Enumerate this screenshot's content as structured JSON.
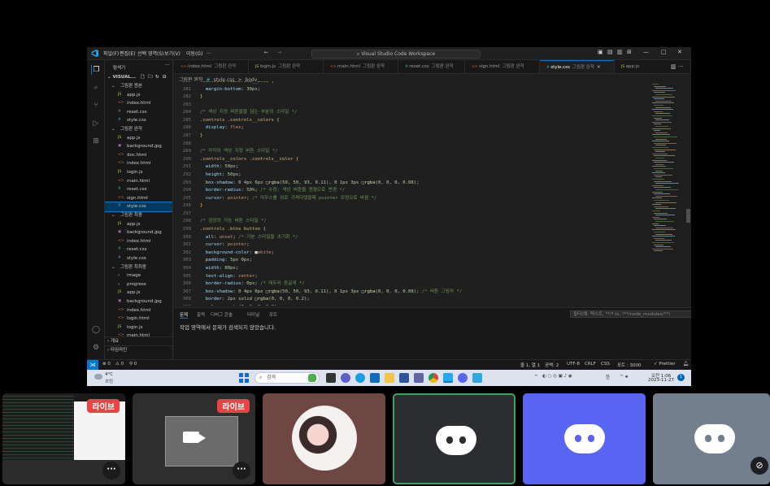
{
  "window": {
    "menu": [
      "파일(F)",
      "편집(E)",
      "선택 영역(S)",
      "보기(V)",
      "이동(G)",
      "..."
    ],
    "command_center": "Visual Studio Code Workspace"
  },
  "sidebar": {
    "title": "탐색기",
    "workspace": "VISUAL...",
    "items": [
      {
        "label": "그림판 원본",
        "type": "folder",
        "depth": 1,
        "open": true
      },
      {
        "label": "app.js",
        "type": "js",
        "depth": 2
      },
      {
        "label": "index.html",
        "type": "html",
        "depth": 2
      },
      {
        "label": "reset.css",
        "type": "css",
        "depth": 2
      },
      {
        "label": "style.css",
        "type": "css",
        "depth": 2
      },
      {
        "label": "그림판 완작",
        "type": "folder",
        "depth": 1,
        "open": true
      },
      {
        "label": "app.js",
        "type": "js",
        "depth": 2
      },
      {
        "label": "background.jpg",
        "type": "img",
        "depth": 2
      },
      {
        "label": "doc.html",
        "type": "html",
        "depth": 2
      },
      {
        "label": "index.html",
        "type": "html",
        "depth": 2
      },
      {
        "label": "login.js",
        "type": "js",
        "depth": 2
      },
      {
        "label": "main.html",
        "type": "html",
        "depth": 2
      },
      {
        "label": "reset.css",
        "type": "css",
        "depth": 2
      },
      {
        "label": "sign.html",
        "type": "html",
        "depth": 2
      },
      {
        "label": "style.css",
        "type": "css",
        "depth": 2,
        "selected": true
      },
      {
        "label": "그림판 최종",
        "type": "folder",
        "depth": 1,
        "open": true
      },
      {
        "label": "app.js",
        "type": "js",
        "depth": 2
      },
      {
        "label": "background.jpg",
        "type": "img",
        "depth": 2
      },
      {
        "label": "index.html",
        "type": "html",
        "depth": 2
      },
      {
        "label": "reset.css",
        "type": "css",
        "depth": 2
      },
      {
        "label": "style.css",
        "type": "css",
        "depth": 2
      },
      {
        "label": "그림판 최최종",
        "type": "folder",
        "depth": 1,
        "open": true
      },
      {
        "label": "image",
        "type": "folder",
        "depth": 2,
        "open": false
      },
      {
        "label": "progress",
        "type": "folder",
        "depth": 2,
        "open": false
      },
      {
        "label": "app.js",
        "type": "js",
        "depth": 2
      },
      {
        "label": "background.jpg",
        "type": "img",
        "depth": 2
      },
      {
        "label": "index.html",
        "type": "html",
        "depth": 2
      },
      {
        "label": "login.html",
        "type": "html",
        "depth": 2
      },
      {
        "label": "login.js",
        "type": "js",
        "depth": 2
      },
      {
        "label": "main.html",
        "type": "html",
        "depth": 2
      }
    ],
    "outline": "개요",
    "timeline": "타임라인"
  },
  "tabs": [
    {
      "file": "index.html",
      "folder": "그림판 완작",
      "type": "html"
    },
    {
      "file": "login.js",
      "folder": "그림판 완작",
      "type": "js"
    },
    {
      "file": "main.html",
      "folder": "그림판 완작",
      "type": "html"
    },
    {
      "file": "reset.css",
      "folder": "그림판 완작",
      "type": "css"
    },
    {
      "file": "sign.html",
      "folder": "그림판 완작",
      "type": "html"
    },
    {
      "file": "style.css",
      "folder": "그림판 완작",
      "type": "css",
      "active": true
    },
    {
      "file": "app.js",
      "folder": "",
      "type": "js"
    }
  ],
  "breadcrumb": [
    "그림판 완작",
    "#",
    "style.css",
    ">",
    "body"
  ],
  "code": [
    {
      "n": "280",
      "parts": [
        [
          ".controls .controls__btns {",
          "sel"
        ]
      ]
    },
    {
      "n": "281",
      "parts": [
        [
          "  margin-bottom",
          "prop"
        ],
        [
          ": ",
          ""
        ],
        [
          "30px",
          "num"
        ],
        [
          ";",
          ""
        ]
      ]
    },
    {
      "n": "282",
      "parts": [
        [
          "}",
          "brace"
        ]
      ]
    },
    {
      "n": "283",
      "parts": []
    },
    {
      "n": "284",
      "parts": [
        [
          "/* 색상 지정 버튼들을 담는 부분의 스타일 */",
          "cmt"
        ]
      ]
    },
    {
      "n": "285",
      "parts": [
        [
          ".controls .controls__colors {",
          "sel"
        ]
      ]
    },
    {
      "n": "286",
      "parts": [
        [
          "  display",
          "prop"
        ],
        [
          ": ",
          ""
        ],
        [
          "flex",
          "val"
        ],
        [
          ";",
          ""
        ]
      ]
    },
    {
      "n": "287",
      "parts": [
        [
          "}",
          "brace"
        ]
      ]
    },
    {
      "n": "288",
      "parts": []
    },
    {
      "n": "289",
      "parts": [
        [
          "/* 각각의 색상 지정 버튼 스타일 */",
          "cmt"
        ]
      ]
    },
    {
      "n": "290",
      "parts": [
        [
          ".controls__colors .controls__color {",
          "sel"
        ]
      ]
    },
    {
      "n": "291",
      "parts": [
        [
          "  width",
          "prop"
        ],
        [
          ": ",
          ""
        ],
        [
          "50px",
          "num"
        ],
        [
          ";",
          ""
        ]
      ]
    },
    {
      "n": "292",
      "parts": [
        [
          "  height",
          "prop"
        ],
        [
          ": ",
          ""
        ],
        [
          "50px",
          "num"
        ],
        [
          ";",
          ""
        ]
      ]
    },
    {
      "n": "293",
      "parts": [
        [
          "  box-shadow",
          "prop"
        ],
        [
          ": ",
          ""
        ],
        [
          "0 4px 6px ",
          "num"
        ],
        [
          "□",
          ""
        ],
        [
          "rgba",
          "fn"
        ],
        [
          "(50, 50, 93, 0.11), 0 1px 3px ",
          "num"
        ],
        [
          "□",
          ""
        ],
        [
          "rgba",
          "fn"
        ],
        [
          "(0, 0, 0, 0.08);",
          "num"
        ]
      ]
    },
    {
      "n": "294",
      "parts": [
        [
          "  border-radius",
          "prop"
        ],
        [
          ": ",
          ""
        ],
        [
          "50%",
          "num"
        ],
        [
          "; ",
          ""
        ],
        [
          "/* 수정: 색상 버튼을 원형으로 변경 */",
          "cmt"
        ]
      ]
    },
    {
      "n": "295",
      "parts": [
        [
          "  cursor",
          "prop"
        ],
        [
          ": ",
          ""
        ],
        [
          "pointer",
          "val"
        ],
        [
          "; ",
          ""
        ],
        [
          "/* 마우스를 위로 가져다댔을때 pointer 모양으로 바뀜 */",
          "cmt"
        ]
      ]
    },
    {
      "n": "296",
      "parts": [
        [
          "}",
          "brace"
        ]
      ]
    },
    {
      "n": "297",
      "parts": []
    },
    {
      "n": "298",
      "parts": [
        [
          "/* 검정의 기능 버튼 스타일 */",
          "cmt"
        ]
      ]
    },
    {
      "n": "299",
      "parts": [
        [
          ".controls .btns button {",
          "sel"
        ]
      ]
    },
    {
      "n": "300",
      "parts": [
        [
          "  all",
          "prop"
        ],
        [
          ": ",
          ""
        ],
        [
          "unset",
          "val"
        ],
        [
          "; ",
          ""
        ],
        [
          "/* 기본 스타일을 초기화 */",
          "cmt"
        ]
      ]
    },
    {
      "n": "301",
      "parts": [
        [
          "  cursor",
          "prop"
        ],
        [
          ": ",
          ""
        ],
        [
          "pointer",
          "val"
        ],
        [
          ";",
          ""
        ]
      ]
    },
    {
      "n": "302",
      "parts": [
        [
          "  background-color",
          "prop"
        ],
        [
          ": ",
          ""
        ],
        [
          "■",
          ""
        ],
        [
          "white",
          "val"
        ],
        [
          ";",
          ""
        ]
      ]
    },
    {
      "n": "303",
      "parts": [
        [
          "  padding",
          "prop"
        ],
        [
          ": ",
          ""
        ],
        [
          "5px 0px",
          "num"
        ],
        [
          ";",
          ""
        ]
      ]
    },
    {
      "n": "304",
      "parts": [
        [
          "  width",
          "prop"
        ],
        [
          ": ",
          ""
        ],
        [
          "80px",
          "num"
        ],
        [
          ";",
          ""
        ]
      ]
    },
    {
      "n": "305",
      "parts": [
        [
          "  text-align",
          "prop"
        ],
        [
          ": ",
          ""
        ],
        [
          "center",
          "val"
        ],
        [
          ";",
          ""
        ]
      ]
    },
    {
      "n": "306",
      "parts": [
        [
          "  border-radius",
          "prop"
        ],
        [
          ": ",
          ""
        ],
        [
          "0px",
          "num"
        ],
        [
          "; ",
          ""
        ],
        [
          "/* 테두리 둥글게 */",
          "cmt"
        ]
      ]
    },
    {
      "n": "307",
      "parts": [
        [
          "  box-shadow",
          "prop"
        ],
        [
          ": ",
          ""
        ],
        [
          "0 4px 6px ",
          "num"
        ],
        [
          "□",
          ""
        ],
        [
          "rgba",
          "fn"
        ],
        [
          "(50, 50, 93, 0.11), 0 1px 3px ",
          "num"
        ],
        [
          "□",
          ""
        ],
        [
          "rgba",
          "fn"
        ],
        [
          "(0, 0, 0, 0.08); ",
          "num"
        ],
        [
          "/* 버튼 그림자 */",
          "cmt"
        ]
      ]
    },
    {
      "n": "308",
      "parts": [
        [
          "  border",
          "prop"
        ],
        [
          ": ",
          ""
        ],
        [
          "2px solid ",
          "num"
        ],
        [
          "□",
          ""
        ],
        [
          "rgba",
          "fn"
        ],
        [
          "(0, 0, 0, 0.2);",
          "num"
        ]
      ]
    },
    {
      "n": "309",
      "parts": [
        [
          "  color",
          "prop"
        ],
        [
          ": ",
          ""
        ],
        [
          "□",
          ""
        ],
        [
          "rgba",
          "fn"
        ],
        [
          "(0, 0, 0, 0.8);",
          "num"
        ]
      ]
    }
  ],
  "panel": {
    "tabs": [
      "문제",
      "출력",
      "디버그 콘솔",
      "터미널",
      "포트"
    ],
    "filter_placeholder": "필터(예: 텍스트, **/*.ts, !**/node_modules/**)",
    "message": "작업 영역에서 문제가 검색되지 않았습니다."
  },
  "statusbar": {
    "errors": "⊗ 0",
    "warnings": "⚠ 0",
    "ports": "⚲ 0",
    "position": "줄 1, 열 1",
    "spaces": "공백: 2",
    "encoding": "UTF-8",
    "eol": "CRLF",
    "language": "CSS",
    "golive": "포트 : 3000",
    "prettier": "✓ Prettier"
  },
  "taskbar": {
    "weather_temp": "4°C",
    "weather_text": "흐림",
    "search_label": "검색",
    "ime": "한",
    "time": "오전 1:06",
    "date": "2023-11-27"
  },
  "discord": {
    "live_label": "라이브",
    "more": "···",
    "blurple": "#5865f2",
    "tile_bg": "#2b2d31"
  },
  "colors": {
    "accent": "#0078d4",
    "editor_bg": "#1f1f1f"
  }
}
